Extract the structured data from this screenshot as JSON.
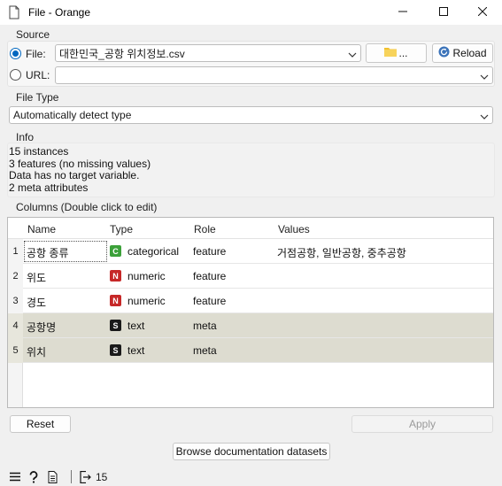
{
  "window": {
    "title": "File - Orange"
  },
  "source": {
    "group_label": "Source",
    "file_label": "File:",
    "file_value": "대한민국_공항 위치정보.csv",
    "browse_label": "...",
    "reload_label": "Reload",
    "url_label": "URL:",
    "url_value": ""
  },
  "file_type": {
    "group_label": "File Type",
    "value": "Automatically detect type"
  },
  "info": {
    "group_label": "Info",
    "lines": [
      "15 instances",
      "3 features (no missing values)",
      "Data has no target variable.",
      "2 meta attributes"
    ]
  },
  "columns": {
    "group_label": "Columns (Double click to edit)",
    "headers": [
      "Name",
      "Type",
      "Role",
      "Values"
    ],
    "rows": [
      {
        "index": "1",
        "name": "공항 종류",
        "badge": "C",
        "type": "categorical",
        "role": "feature",
        "values": "거점공항, 일반공항, 중추공항"
      },
      {
        "index": "2",
        "name": "위도",
        "badge": "N",
        "type": "numeric",
        "role": "feature",
        "values": ""
      },
      {
        "index": "3",
        "name": "경도",
        "badge": "N",
        "type": "numeric",
        "role": "feature",
        "values": ""
      },
      {
        "index": "4",
        "name": "공항명",
        "badge": "S",
        "type": "text",
        "role": "meta",
        "values": ""
      },
      {
        "index": "5",
        "name": "위치",
        "badge": "S",
        "type": "text",
        "role": "meta",
        "values": ""
      }
    ]
  },
  "buttons": {
    "reset": "Reset",
    "apply": "Apply",
    "browse_docs": "Browse documentation datasets"
  },
  "statusbar": {
    "output_count": "15"
  },
  "icons": [
    "orange-app-icon",
    "minimize-icon",
    "maximize-icon",
    "close-icon",
    "folder-icon",
    "reload-icon",
    "chevron-down-icon",
    "menu-icon",
    "help-icon",
    "document-icon",
    "output-icon"
  ]
}
